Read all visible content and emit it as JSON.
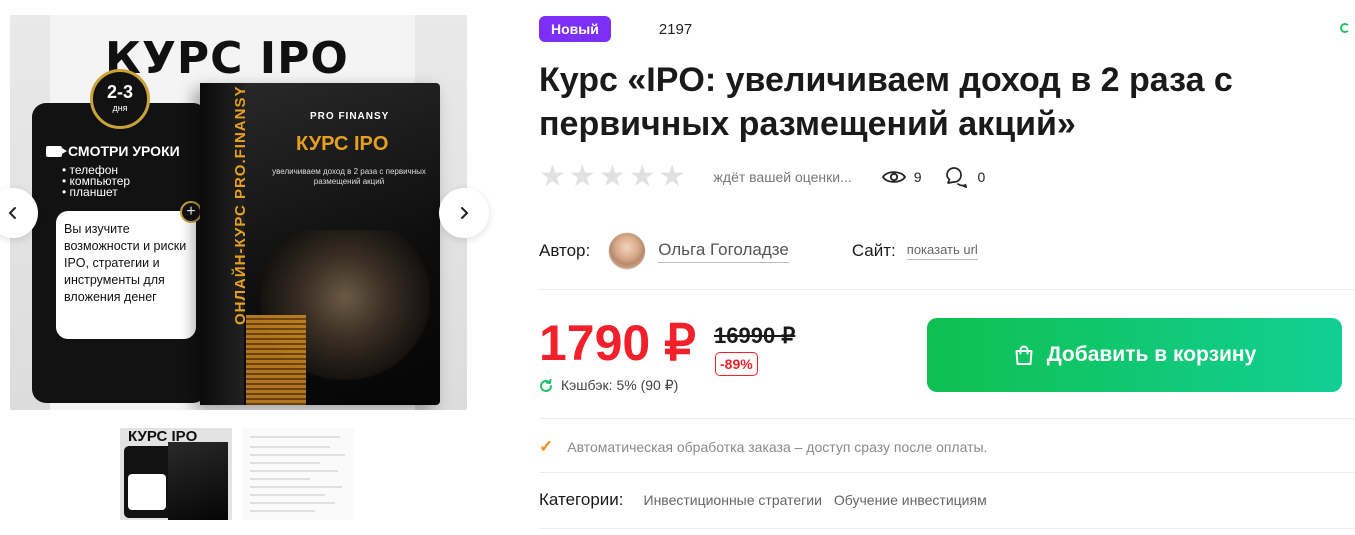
{
  "gallery": {
    "cover": {
      "title": "КУРС IPO",
      "days_big": "2-3",
      "days_small": "дня",
      "watch_label": "СМОТРИ УРОКИ",
      "devices": [
        "телефон",
        "компьютер",
        "планшет"
      ],
      "note": "Вы изучите возможности и риски IPO, стратегии и инструменты для вложения денег",
      "plus": "+",
      "box_brand": "PRO FINANSY",
      "box_title": "КУРС IPO",
      "box_subtitle": "увеличиваем доход в 2 раза с первичных размещений акций",
      "spine": "ОНЛАЙН-КУРС PRO.FINANSY"
    },
    "thumbs": {
      "thumb1_title": "КУРС IPO"
    },
    "prev_icon": "chevron-left-icon",
    "next_icon": "chevron-right-icon"
  },
  "product": {
    "badge": "Новый",
    "sku": "2197",
    "title": "Курс «IPO: увеличиваем доход в 2 раза с первичных размещений акций»",
    "rating_text": "ждёт вашей оценки...",
    "views": "9",
    "comments": "0",
    "author_label": "Автор:",
    "author_name": "Ольга Гоголадзе",
    "site_label": "Сайт:",
    "site_link": "показать url",
    "price": "1790 ₽",
    "price_old": "16990 ₽",
    "discount": "-89%",
    "cashback": "Кэшбэк: 5% (90 ₽)",
    "cart_button": "Добавить в корзину",
    "auto_note": "Автоматическая обработка заказа – доступ сразу после оплаты.",
    "categories_label": "Категории:",
    "categories": [
      "Инвестиционные стратегии",
      "Обучение инвестициям"
    ]
  },
  "colors": {
    "badge": "#7b2ff7",
    "price": "#f2202a",
    "cart_start": "#0fc050",
    "cart_end": "#12cf94",
    "check": "#f28b1c"
  }
}
